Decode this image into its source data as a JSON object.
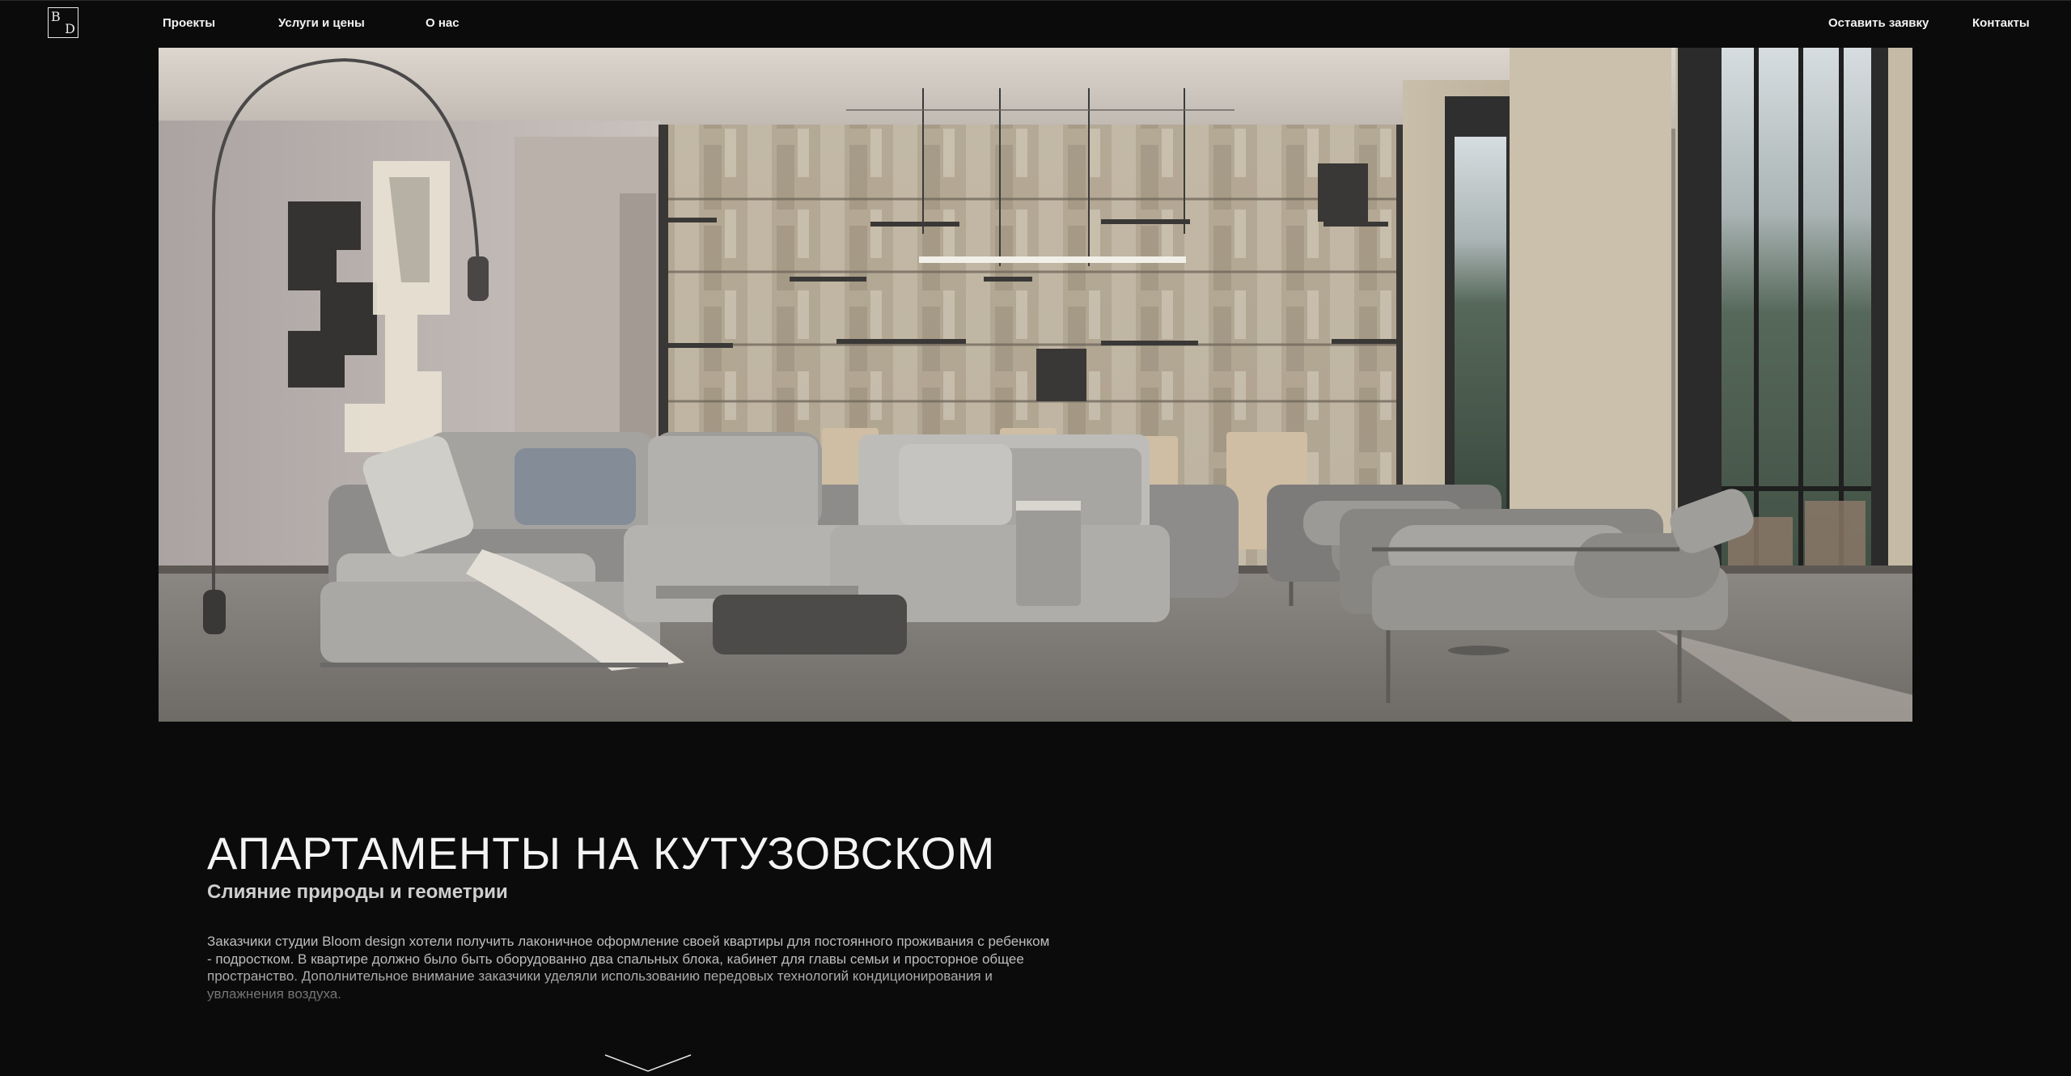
{
  "header": {
    "logo": {
      "top": "B",
      "bottom": "D"
    },
    "nav": {
      "projects": "Проекты",
      "services": "Услуги и цены",
      "about": "О нас"
    },
    "cta": "Оставить заявку",
    "contacts": "Контакты"
  },
  "project": {
    "title": "АПАРТАМЕНТЫ НА КУТУЗОВСКОМ",
    "subtitle": "Слияние природы и геометрии",
    "description": "Заказчики студии Bloom design хотели получить лаконичное оформление своей квартиры для постоянного проживания с ребенком - подростком. В квартире должно было быть оборудованно два спальных блока, кабинет для главы семьи и просторное общее пространство. Дополнительное внимание заказчики уделяли использованию передовых технологий кондиционирования и увлажнения воздуха."
  },
  "icons": {
    "expand": "chevron-down-icon"
  },
  "colors": {
    "background": "#0b0b0b",
    "text": "#ffffff"
  }
}
